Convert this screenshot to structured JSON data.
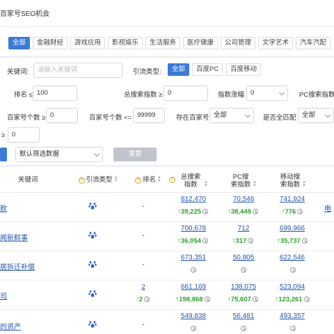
{
  "header": {
    "title": "百家号SEO机会"
  },
  "categories": [
    {
      "label": "全部",
      "active": true
    },
    {
      "label": "金融财经"
    },
    {
      "label": "游戏应用"
    },
    {
      "label": "影视娱乐"
    },
    {
      "label": "生活服务"
    },
    {
      "label": "医疗健康"
    },
    {
      "label": "公司管理"
    },
    {
      "label": "文学艺术"
    },
    {
      "label": "汽车汽配"
    }
  ],
  "filters": {
    "keyword_label": "关键词:",
    "keyword_placeholder": "请输入关键词",
    "source_type_label": "引流类型:",
    "source_type_options": [
      "全部",
      "百度PC",
      "百度移动"
    ],
    "rank_label": "排名 ≤",
    "rank_value": "100",
    "total_index_label": "总搜索指数 ≥",
    "total_index_value": "0",
    "index_change_label": "指数涨幅",
    "index_change_value": "0",
    "pc_index_label": "PC搜索指数",
    "bjh_count_min_label": "百家号个数 ≥",
    "bjh_count_min_value": "0",
    "bjh_count_max_label": "百家号个数 <=",
    "bjh_count_max_value": "99999",
    "exists_label": "存在百家号",
    "exists_value": "全部",
    "exact_label": "是否全匹配",
    "exact_value": "全部",
    "misc_label": "≥",
    "misc_value": "0",
    "default_filter": "默认筛选数据",
    "reset_label": "重置"
  },
  "table": {
    "headers": {
      "keyword": "关键词",
      "source_type": "引流类型",
      "rank": "排名",
      "total_index": "总搜索指数",
      "pc_index": "PC搜索指数",
      "mobile_index": "移动搜索指数"
    },
    "rows": [
      {
        "keyword": "款",
        "rank": "-",
        "total": "812,470",
        "total_change": "↑39,225",
        "pc": "70,546",
        "pc_change": "↑38,449",
        "mobile": "741,924",
        "mobile_change": "↑776",
        "extra": "电"
      },
      {
        "keyword": "闻新鲜事",
        "rank": "-",
        "total": "700,678",
        "total_change": "↑36,054",
        "pc": "712",
        "pc_change": "↑317",
        "mobile": "699,966",
        "mobile_change": "↑35,737",
        "extra": ""
      },
      {
        "keyword": "居拆迁补偿",
        "rank": "-",
        "total": "673,351",
        "total_change": "",
        "pc": "50,805",
        "pc_change": "",
        "mobile": "622,546",
        "mobile_change": "",
        "extra": ""
      },
      {
        "keyword": "司",
        "rank": "2",
        "rank_change": "↑2",
        "total": "661,169",
        "total_change": "↑198,868",
        "pc": "138,075",
        "pc_change": "↑75,607",
        "mobile": "523,094",
        "mobile_change": "↑123,261",
        "extra": ""
      },
      {
        "keyword": "的资产",
        "rank": "-",
        "total": "549,838",
        "total_change": "",
        "pc": "56,481",
        "pc_change": "",
        "mobile": "493,357",
        "mobile_change": "",
        "extra": ""
      }
    ]
  },
  "colors": {
    "accent": "#3a7bd5",
    "up": "#2e9e2e",
    "link": "#2255aa",
    "paw": "#2f5fd0"
  },
  "icons": {
    "source": "baidu-paw-icon",
    "help": "question-circle-icon",
    "history": "clock-icon"
  }
}
